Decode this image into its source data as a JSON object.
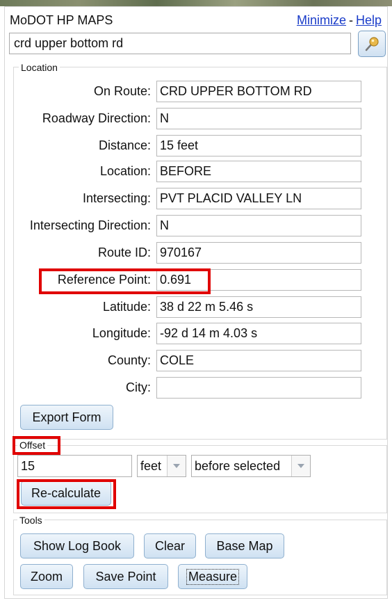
{
  "header": {
    "title": "MoDOT HP MAPS",
    "minimize_label": "Minimize",
    "separator": "-",
    "help_label": "Help"
  },
  "search": {
    "value": "crd upper bottom rd",
    "button_icon": "locate-pin-icon"
  },
  "location": {
    "legend": "Location",
    "fields": [
      {
        "label": "On Route:",
        "value": "CRD UPPER BOTTOM RD"
      },
      {
        "label": "Roadway Direction:",
        "value": "N"
      },
      {
        "label": "Distance:",
        "value": "15 feet"
      },
      {
        "label": "Location:",
        "value": "BEFORE"
      },
      {
        "label": "Intersecting:",
        "value": "PVT PLACID VALLEY LN"
      },
      {
        "label": "Intersecting Direction:",
        "value": "N"
      },
      {
        "label": "Route ID:",
        "value": "970167"
      },
      {
        "label": "Reference Point:",
        "value": "0.691"
      },
      {
        "label": "Latitude:",
        "value": "38 d 22 m 5.46 s"
      },
      {
        "label": "Longitude:",
        "value": "-92 d 14 m 4.03 s"
      },
      {
        "label": "County:",
        "value": "COLE"
      },
      {
        "label": "City:",
        "value": ""
      }
    ],
    "export_label": "Export Form"
  },
  "offset": {
    "legend": "Offset",
    "value": "15",
    "unit": "feet",
    "position": "before selected",
    "recalc_label": "Re-calculate"
  },
  "tools": {
    "legend": "Tools",
    "log_book_label": "Show Log Book",
    "clear_label": "Clear",
    "base_map_label": "Base Map",
    "zoom_label": "Zoom",
    "save_point_label": "Save Point",
    "measure_label": "Measure"
  },
  "colors": {
    "highlight": "#e00000",
    "link": "#1a3cc9",
    "button_top": "#eef5fb",
    "button_bottom": "#cfe1f2"
  }
}
